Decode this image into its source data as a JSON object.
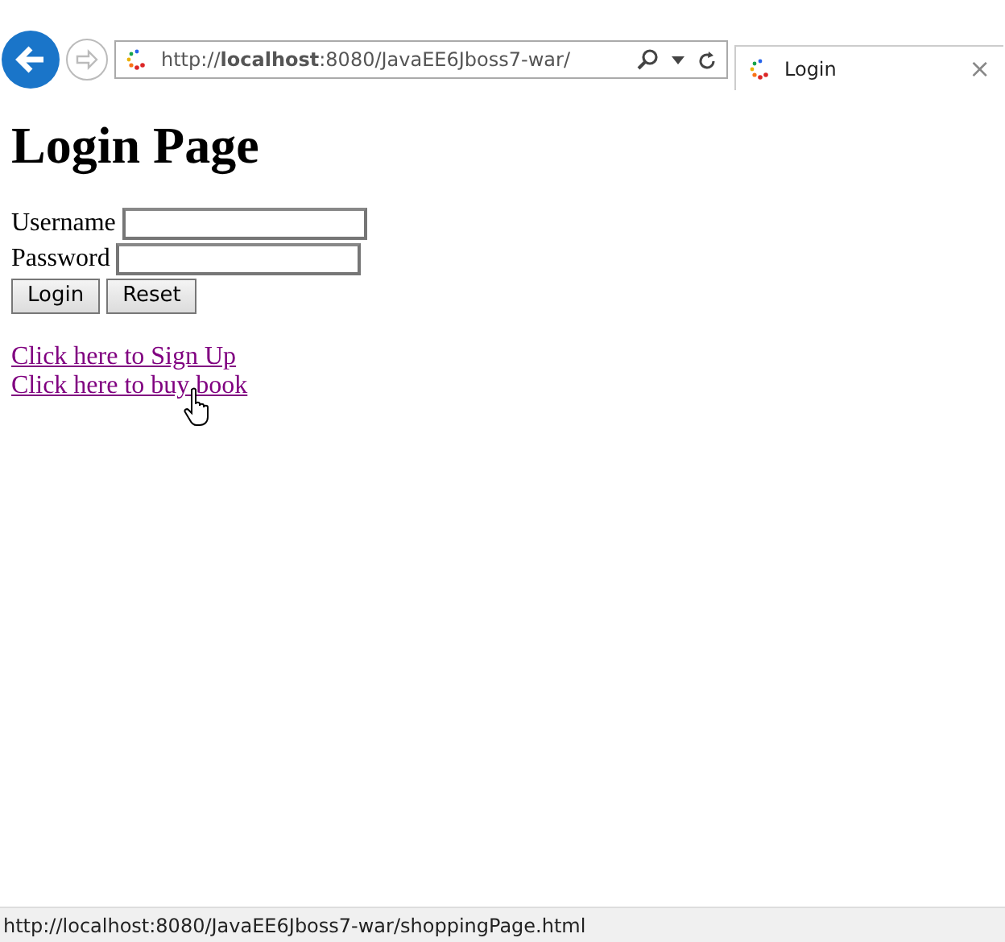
{
  "browser": {
    "address": "http://**localhost**:8080/JavaEE6Jboss7-war/",
    "tab": {
      "title": "Login",
      "close": "×"
    }
  },
  "page": {
    "heading": "Login Page",
    "fields": [
      {
        "label": "Username"
      },
      {
        "label": "Password"
      }
    ],
    "buttons": [
      "Login",
      "Reset"
    ],
    "links": [
      "Click here to Sign Up",
      "Click here to buy book"
    ]
  },
  "status_bar": "http://localhost:8080/JavaEE6Jboss7-war/shoppingPage.html"
}
